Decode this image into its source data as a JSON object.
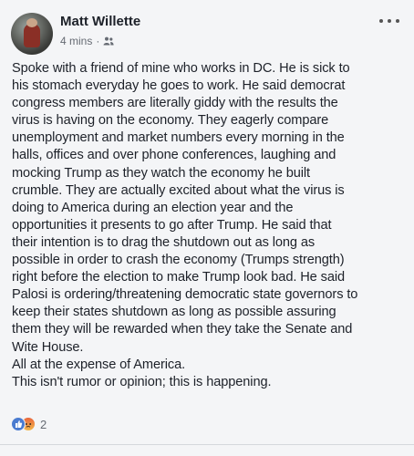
{
  "post": {
    "author": "Matt Willette",
    "timestamp": "4 mins",
    "separator": "·",
    "privacy_icon": "friends-icon",
    "body": "Spoke with a friend of mine who works in DC. He is sick to\nhis stomach everyday he goes to work. He said democrat\ncongress members are literally giddy with the results the\nvirus is having on the economy. They eagerly compare\nunemployment and market numbers every morning in the\nhalls, offices and over phone conferences, laughing and\nmocking Trump as they watch the economy he built\ncrumble. They are actually excited about what the virus is\ndoing to America during an election year and the\nopportunities it presents to go after Trump. He said that\ntheir intention is to drag the shutdown out as long as\npossible in order to crash the economy (Trumps strength)\nright before the election to make Trump look bad. He said\nPalosi is ordering/threatening democratic state governors to\nkeep their states shutdown as long as possible assuring\nthem they will be rewarded when they take the Senate and\nWite House.\nAll at the expense of America.\nThis isn't rumor or opinion; this is happening.",
    "reactions": {
      "icons": [
        "like-icon",
        "angry-icon"
      ],
      "count": "2"
    }
  },
  "colors": {
    "like": "#4a7bd0",
    "angry": "#e9653b",
    "text": "#1d2129",
    "meta": "#666b73",
    "background": "#f4f5f7"
  }
}
